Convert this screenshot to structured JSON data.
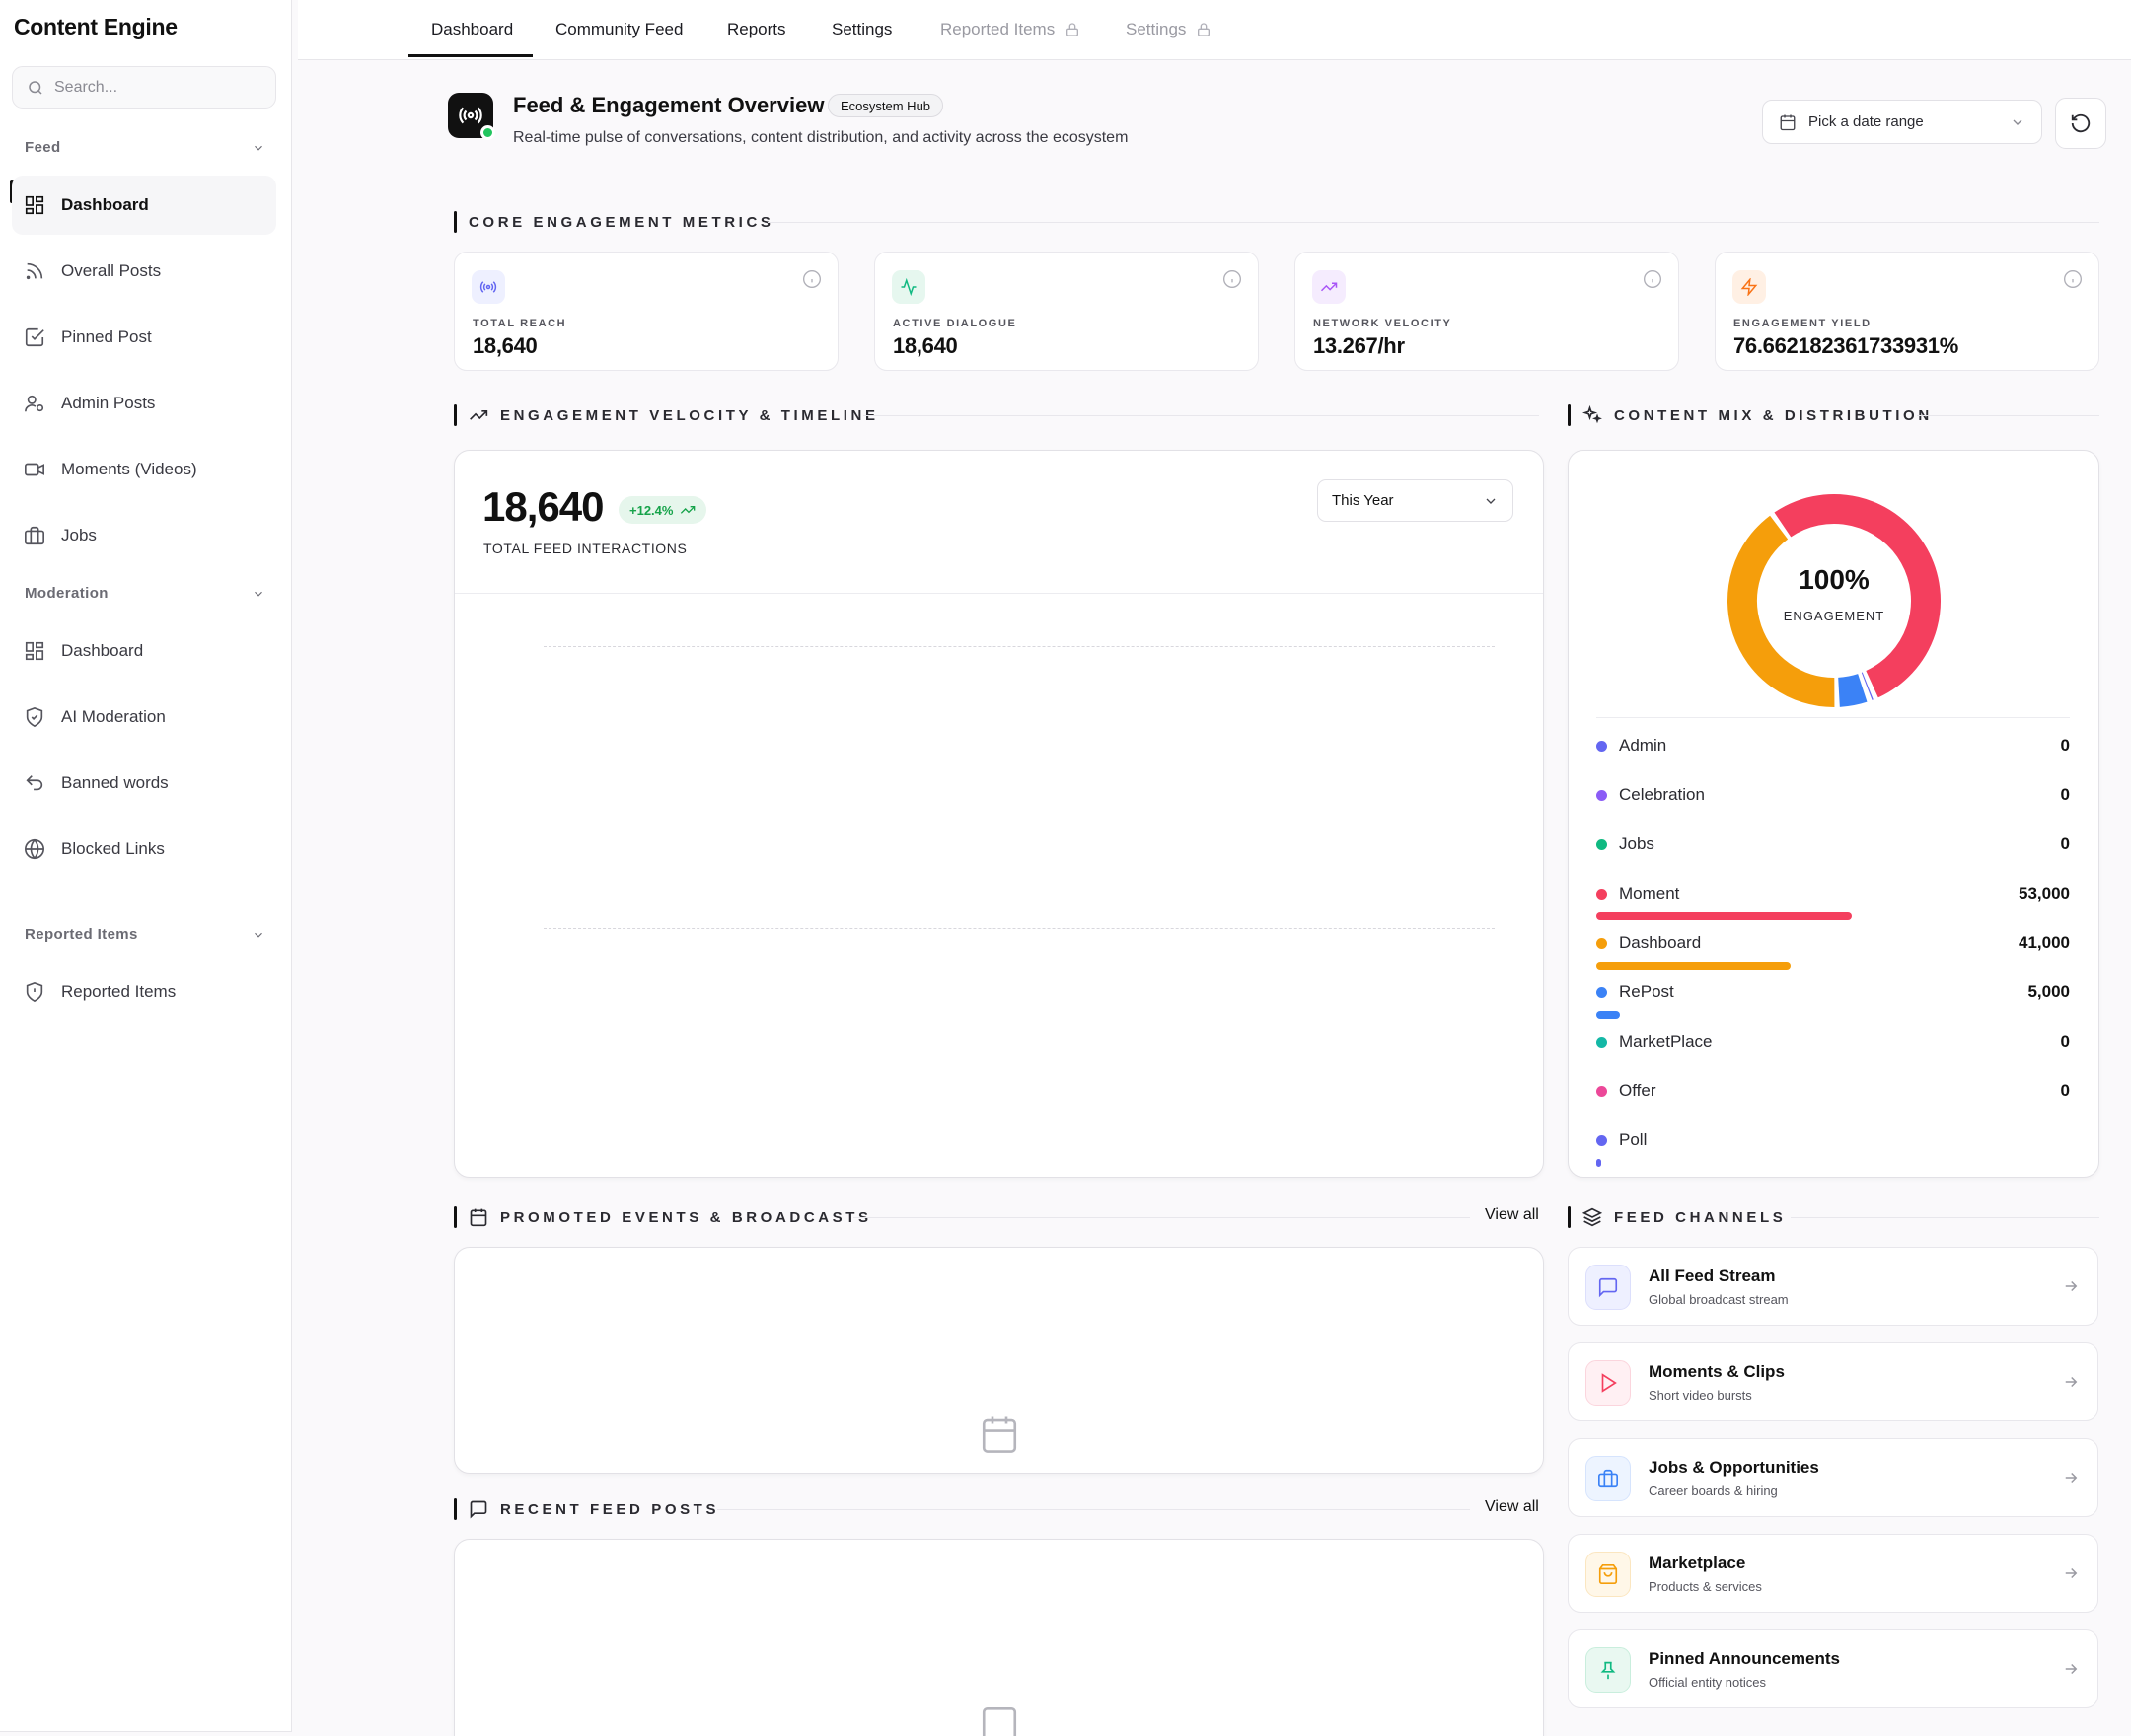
{
  "app": {
    "title": "Content Engine"
  },
  "sidebar": {
    "search_placeholder": "Search...",
    "sections": [
      {
        "title": "Feed",
        "items": [
          {
            "label": "Dashboard",
            "icon": "grid-icon",
            "active": true
          },
          {
            "label": "Overall Posts",
            "icon": "rss-icon"
          },
          {
            "label": "Pinned Post",
            "icon": "check-square-icon"
          },
          {
            "label": "Admin Posts",
            "icon": "user-cog-icon"
          },
          {
            "label": "Moments (Videos)",
            "icon": "video-icon"
          },
          {
            "label": "Jobs",
            "icon": "briefcase-icon"
          }
        ]
      },
      {
        "title": "Moderation",
        "items": [
          {
            "label": "Dashboard",
            "icon": "grid-icon"
          },
          {
            "label": "AI Moderation",
            "icon": "shield-check-icon"
          },
          {
            "label": "Banned words",
            "icon": "undo-icon"
          },
          {
            "label": "Blocked Links",
            "icon": "globe-icon"
          }
        ]
      },
      {
        "title": "Reported Items",
        "items": [
          {
            "label": "Reported Items",
            "icon": "shield-alert-icon"
          }
        ]
      }
    ]
  },
  "tabs": [
    {
      "label": "Dashboard",
      "active": true
    },
    {
      "label": "Community Feed"
    },
    {
      "label": "Reports"
    },
    {
      "label": "Settings"
    },
    {
      "label": "Reported Items",
      "locked": true
    },
    {
      "label": "Settings",
      "locked": true
    }
  ],
  "header": {
    "title": "Feed & Engagement Overview",
    "badge": "Ecosystem Hub",
    "subtitle": "Real-time pulse of conversations, content distribution, and activity across the ecosystem",
    "date_placeholder": "Pick a date range"
  },
  "core_metrics": {
    "heading": "CORE ENGAGEMENT METRICS",
    "cards": [
      {
        "label": "TOTAL REACH",
        "value": "18,640",
        "icon": "broadcast-icon",
        "color": "#6366f1"
      },
      {
        "label": "ACTIVE DIALOGUE",
        "value": "18,640",
        "icon": "activity-icon",
        "color": "#10b981"
      },
      {
        "label": "NETWORK VELOCITY",
        "value": "13.267/hr",
        "icon": "trending-up-icon",
        "color": "#a855f7"
      },
      {
        "label": "ENGAGEMENT YIELD",
        "value": "76.6621823617339 31%",
        "icon": "zap-icon",
        "color": "#f97316"
      }
    ]
  },
  "velocity": {
    "heading": "ENGAGEMENT VELOCITY & TIMELINE",
    "total": "18,640",
    "growth": "+12.4%",
    "caption": "TOTAL FEED INTERACTIONS",
    "range": "This Year"
  },
  "content_mix": {
    "heading": "CONTENT MIX & DISTRIBUTION",
    "center_value": "100%",
    "center_label": "ENGAGEMENT",
    "items": [
      {
        "name": "Admin",
        "value": "0",
        "color": "#6366f1"
      },
      {
        "name": "Celebration",
        "value": "0",
        "color": "#8b5cf6"
      },
      {
        "name": "Jobs",
        "value": "0",
        "color": "#10b981"
      },
      {
        "name": "Moment",
        "value": "53,000",
        "color": "#f43f5e",
        "share": 0.54
      },
      {
        "name": "Dashboard",
        "value": "41,000",
        "color": "#f59e0b",
        "share": 0.41
      },
      {
        "name": "RePost",
        "value": "5,000",
        "color": "#3b82f6",
        "share": 0.05
      },
      {
        "name": "MarketPlace",
        "value": "0",
        "color": "#14b8a6"
      },
      {
        "name": "Offer",
        "value": "0",
        "color": "#ec4899"
      },
      {
        "name": "Poll",
        "value": "",
        "color": "#6366f1",
        "share": 0.01
      }
    ]
  },
  "promoted": {
    "heading": "PROMOTED EVENTS & BROADCASTS",
    "view_all": "View all"
  },
  "recent": {
    "heading": "RECENT FEED POSTS",
    "view_all": "View all"
  },
  "channels": {
    "heading": "FEED CHANNELS",
    "items": [
      {
        "title": "All Feed Stream",
        "subtitle": "Global broadcast stream",
        "icon": "message-square-icon",
        "color": "#6366f1"
      },
      {
        "title": "Moments & Clips",
        "subtitle": "Short video bursts",
        "icon": "play-icon",
        "color": "#f43f5e"
      },
      {
        "title": "Jobs & Opportunities",
        "subtitle": "Career boards & hiring",
        "icon": "briefcase-icon",
        "color": "#3b82f6"
      },
      {
        "title": "Marketplace",
        "subtitle": "Products & services",
        "icon": "shopping-bag-icon",
        "color": "#f59e0b"
      },
      {
        "title": "Pinned Announcements",
        "subtitle": "Official entity notices",
        "icon": "pin-icon",
        "color": "#10b981"
      }
    ]
  }
}
